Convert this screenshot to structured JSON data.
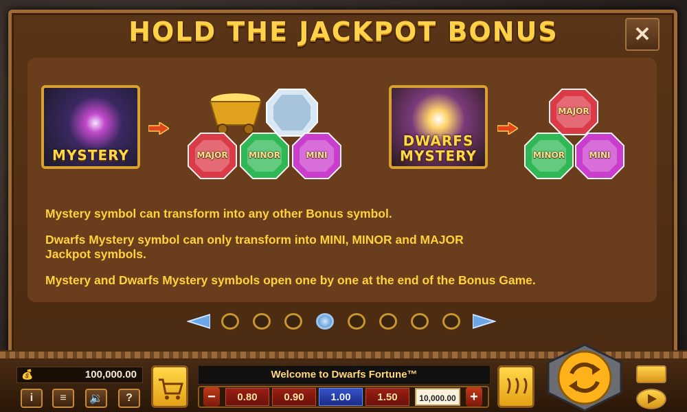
{
  "title": "HOLD THE JACKPOT BONUS",
  "close_icon": "close-icon",
  "symbols": {
    "mystery_label": "MYSTERY",
    "dwarfs_mystery_label_line1": "DWARFS",
    "dwarfs_mystery_label_line2": "MYSTERY"
  },
  "gems_left": [
    {
      "label": "MAJOR",
      "color": "#e23a4a"
    },
    {
      "label": "MINOR",
      "color": "#2fbf5a"
    },
    {
      "label": "MINI",
      "color": "#d03fd8"
    }
  ],
  "gems_right": [
    {
      "label": "MAJOR",
      "color": "#e23a4a"
    },
    {
      "label": "MINOR",
      "color": "#2fbf5a"
    },
    {
      "label": "MINI",
      "color": "#d03fd8"
    }
  ],
  "description": [
    "Mystery symbol can transform into any other Bonus symbol.",
    "Dwarfs Mystery symbol can only transform into MINI, MINOR and MAJOR",
    "Jackpot symbols.",
    "Mystery and Dwarfs Mystery symbols open one by one at the end of the Bonus Game."
  ],
  "pager": {
    "current_page": 4,
    "total_pages": 8
  },
  "balance": "100,000.00",
  "welcome": "Welcome to Dwarfs Fortune™",
  "bets": [
    "0.80",
    "0.90",
    "1.00",
    "1.50"
  ],
  "active_bet": "1.00",
  "total_bet": "10,000.00",
  "controls": {
    "info": "i",
    "menu": "≡",
    "sound": "🔉",
    "help": "?",
    "minus": "−",
    "plus": "+"
  },
  "colors": {
    "accent": "#ffd23c",
    "panel": "#4b2b12",
    "border": "#a06a36"
  }
}
